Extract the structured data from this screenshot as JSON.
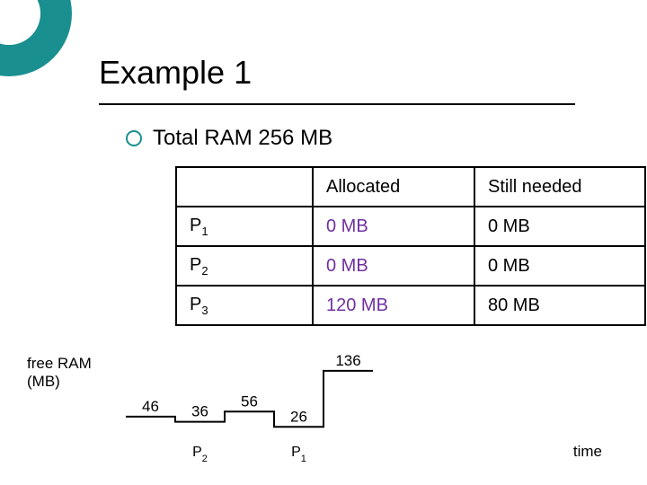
{
  "title": "Example 1",
  "bullet": "Total RAM 256 MB",
  "table": {
    "headers": {
      "proc": "",
      "allocated": "Allocated",
      "still": "Still needed"
    },
    "rows": [
      {
        "proc_base": "P",
        "proc_sub": "1",
        "allocated": "0 MB",
        "still": "0 MB"
      },
      {
        "proc_base": "P",
        "proc_sub": "2",
        "allocated": "0 MB",
        "still": "0 MB"
      },
      {
        "proc_base": "P",
        "proc_sub": "3",
        "allocated": "120 MB",
        "still": "80 MB"
      }
    ]
  },
  "freeRamLabel": {
    "line1": "free RAM",
    "line2": "(MB)"
  },
  "timeAxisLabel": "time",
  "chart_data": {
    "type": "line",
    "title": "",
    "xlabel": "time",
    "ylabel": "free RAM (MB)",
    "ylim": [
      0,
      150
    ],
    "step_values": [
      46,
      36,
      56,
      26,
      136
    ],
    "proc_markers": [
      {
        "name": "P",
        "sub": "2",
        "segment_index": 1
      },
      {
        "name": "P",
        "sub": "1",
        "segment_index": 3
      }
    ]
  }
}
